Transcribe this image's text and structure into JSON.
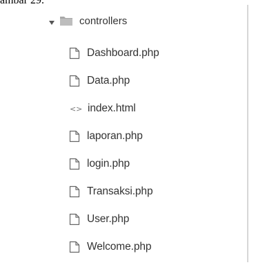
{
  "caption": "ambar 29.",
  "tree": {
    "folder": {
      "name": "controllers",
      "expanded": true
    },
    "files": [
      {
        "name": "Dashboard.php",
        "icon": "file-icon"
      },
      {
        "name": "Data.php",
        "icon": "file-icon"
      },
      {
        "name": "index.html",
        "icon": "code-icon"
      },
      {
        "name": "laporan.php",
        "icon": "file-icon"
      },
      {
        "name": "login.php",
        "icon": "file-icon"
      },
      {
        "name": "Transaksi.php",
        "icon": "file-icon"
      },
      {
        "name": "User.php",
        "icon": "file-icon"
      },
      {
        "name": "Welcome.php",
        "icon": "file-icon"
      }
    ]
  },
  "colors": {
    "text": "#333333",
    "icon": "#666666",
    "folder": "#a8a8a8",
    "divider": "#d7d7d7"
  }
}
